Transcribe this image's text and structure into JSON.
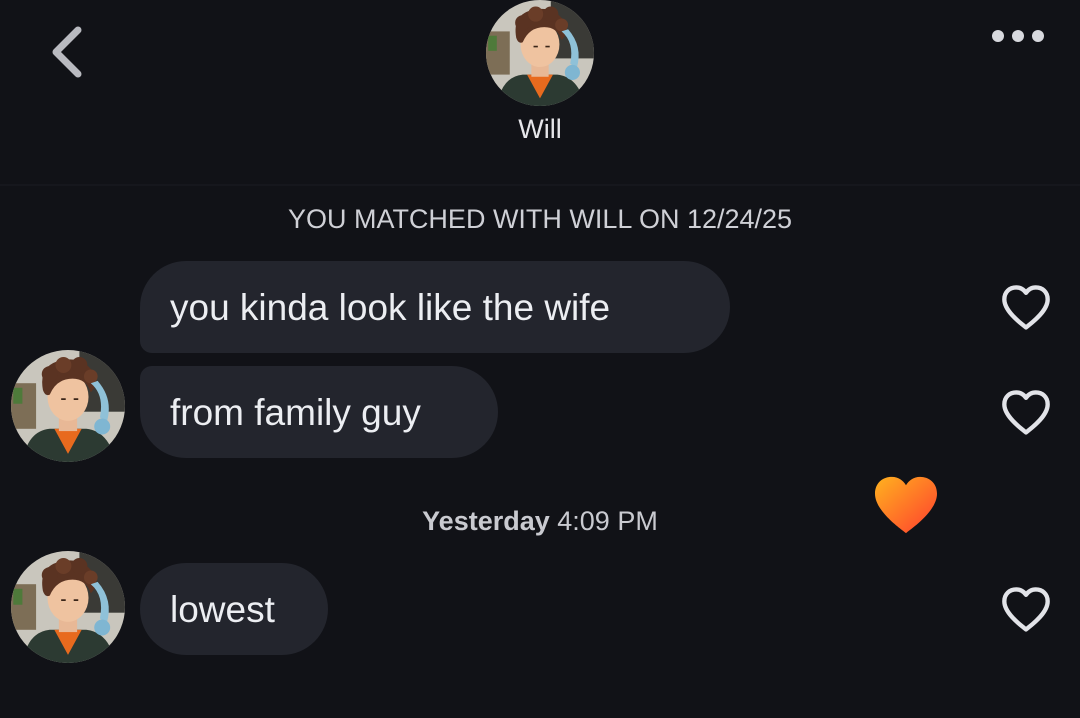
{
  "header": {
    "contact_name": "Will",
    "back_icon": "chevron-left-icon",
    "more_icon": "ellipsis-icon",
    "avatar": "profile-photo"
  },
  "match_banner": "YOU MATCHED WITH WILL ON 12/24/25",
  "messages": [
    {
      "text": "you kinda look like the wife",
      "liked": false
    },
    {
      "text": "from family guy",
      "liked": false
    },
    {
      "text": "lowest",
      "liked": false
    }
  ],
  "timestamp": {
    "day": "Yesterday",
    "time": "4:09 PM"
  },
  "colors": {
    "background": "#111217",
    "bubble": "#23252d",
    "heart_outline": "#e2e3e8",
    "heart_gradient_start": "#ff9b1a",
    "heart_gradient_end": "#ff4a2a"
  }
}
